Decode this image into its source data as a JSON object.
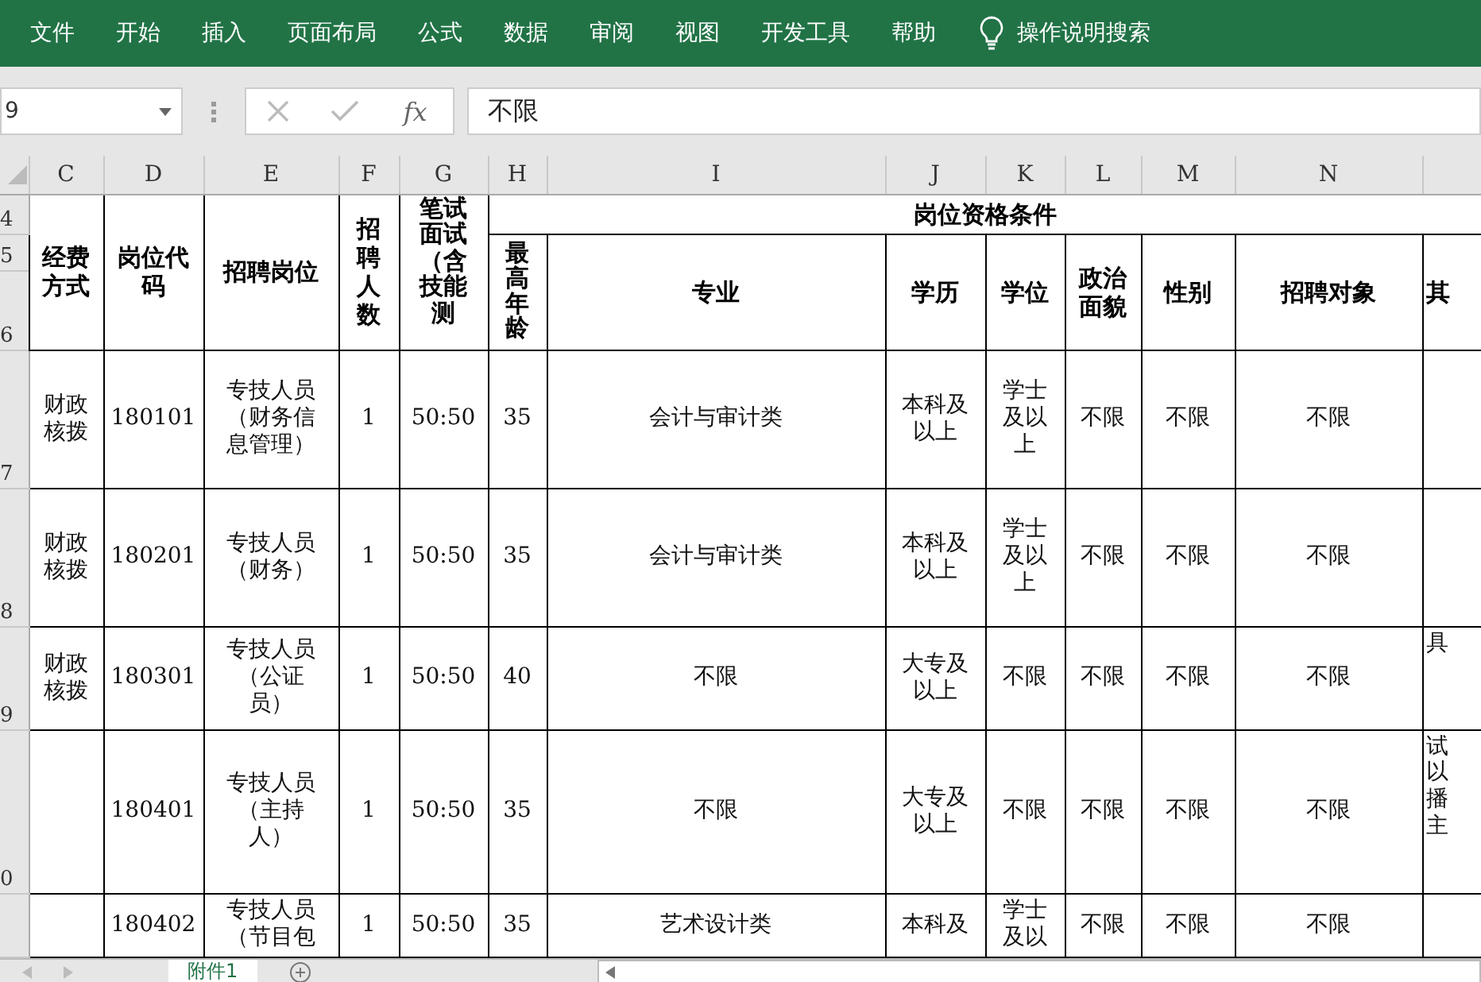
{
  "ribbon": {
    "tabs": [
      {
        "label": "文件",
        "selected": false
      },
      {
        "label": "开始",
        "selected": false
      },
      {
        "label": "插入",
        "selected": false
      },
      {
        "label": "页面布局",
        "selected": false
      },
      {
        "label": "公式",
        "selected": false
      },
      {
        "label": "数据",
        "selected": false
      },
      {
        "label": "审阅",
        "selected": false
      },
      {
        "label": "视图",
        "selected": false
      },
      {
        "label": "开发工具",
        "selected": false
      },
      {
        "label": "帮助",
        "selected": false
      }
    ],
    "tell_me": "操作说明搜索"
  },
  "formula_bar": {
    "name_box": "9",
    "function_button": "fx",
    "formula": "不限"
  },
  "column_headers": [
    "C",
    "D",
    "E",
    "F",
    "G",
    "H",
    "I",
    "J",
    "K",
    "L",
    "M",
    "N"
  ],
  "row_headers": [
    "4",
    "5",
    "6",
    "7",
    "8",
    "9",
    "0"
  ],
  "table": {
    "header": {
      "funding": "经费方式",
      "code": "岗位代码",
      "position": "招聘岗位",
      "count": "招聘人数",
      "ratio": "笔试面试（含技能测",
      "group": "岗位资格条件",
      "age": "最高年龄",
      "major": "专业",
      "education": "学历",
      "degree": "学位",
      "politics": "政治面貌",
      "gender": "性别",
      "target": "招聘对象",
      "column_o": "其"
    },
    "rows": [
      {
        "funding": "财政核拨",
        "code": "180101",
        "position": "专技人员（财务信息管理）",
        "count": "1",
        "ratio": "50:50",
        "age": "35",
        "major": "会计与审计类",
        "education": "本科及以上",
        "degree": "学士及以上",
        "politics": "不限",
        "gender": "不限",
        "target": "不限"
      },
      {
        "funding": "财政核拨",
        "code": "180201",
        "position": "专技人员（财务）",
        "count": "1",
        "ratio": "50:50",
        "age": "35",
        "major": "会计与审计类",
        "education": "本科及以上",
        "degree": "学士及以上",
        "politics": "不限",
        "gender": "不限",
        "target": "不限"
      },
      {
        "funding": "财政核拨",
        "code": "180301",
        "position": "专技人员（公证员）",
        "count": "1",
        "ratio": "50:50",
        "age": "40",
        "major": "不限",
        "education": "大专及以上",
        "degree": "不限",
        "politics": "不限",
        "gender": "不限",
        "target": "不限",
        "column_o": "具"
      },
      {
        "code": "180401",
        "position": "专技人员（主持人）",
        "count": "1",
        "ratio": "50:50",
        "age": "35",
        "major": "不限",
        "education": "大专及以上",
        "degree": "不限",
        "politics": "不限",
        "gender": "不限",
        "target": "不限",
        "column_o": "试以播主"
      },
      {
        "code": "180402",
        "position": "专技人员（节目包",
        "count": "1",
        "ratio": "50:50",
        "age": "35",
        "major": "艺术设计类",
        "education": "本科及",
        "degree": "学士及以",
        "politics": "不限",
        "gender": "不限",
        "target": "不限"
      }
    ]
  },
  "sheet_tabs": [
    {
      "label": "附件1",
      "selected": true
    }
  ]
}
